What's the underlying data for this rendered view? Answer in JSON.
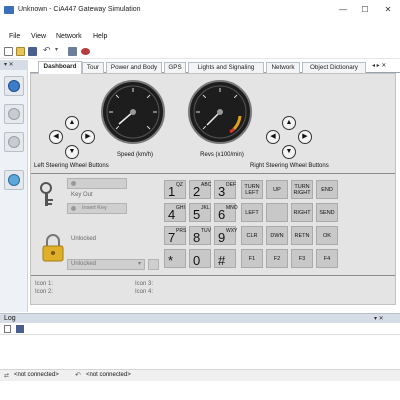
{
  "window": {
    "title": "Unknown - CiA447 Gateway Simulation",
    "minimize": "—",
    "maximize": "☐",
    "close": "✕"
  },
  "menu": [
    "File",
    "View",
    "Network",
    "Help"
  ],
  "left_dock": {
    "header_glyphs": "▾ ✕"
  },
  "tabs": [
    {
      "label": "Dashboard",
      "active": true
    },
    {
      "label": "Tour",
      "active": false
    },
    {
      "label": "Power and Body",
      "active": false
    },
    {
      "label": "GPS",
      "active": false
    },
    {
      "label": "Lights and Signaling",
      "active": false
    },
    {
      "label": "Network",
      "active": false
    },
    {
      "label": "Object Dictionary",
      "active": false
    }
  ],
  "tab_scroll": "◂ ▸ ✕",
  "gauges": {
    "speed_label": "Speed (km/h)",
    "revs_label": "Revs (x100/min)"
  },
  "steering": {
    "left_label": "Left Steering Wheel Buttons",
    "right_label": "Right Steering Wheel Buttons",
    "up": "▲",
    "down": "▼",
    "left": "◀",
    "right": "▶"
  },
  "key_section": {
    "key_out": "Key Out",
    "insert_key": "Insert Key",
    "lock_status": "Unlocked",
    "lock_dropdown": "Unlocked"
  },
  "keypad": [
    {
      "main": "1",
      "sub": "QZ"
    },
    {
      "main": "2",
      "sub": "ABC"
    },
    {
      "main": "3",
      "sub": "DEF"
    },
    {
      "main": "4",
      "sub": "GHI"
    },
    {
      "main": "5",
      "sub": "JKL"
    },
    {
      "main": "6",
      "sub": "MNO"
    },
    {
      "main": "7",
      "sub": "PRS"
    },
    {
      "main": "8",
      "sub": "TUV"
    },
    {
      "main": "9",
      "sub": "WXY"
    },
    {
      "main": "*",
      "sub": ""
    },
    {
      "main": "0",
      "sub": ""
    },
    {
      "main": "#",
      "sub": ""
    }
  ],
  "function_keys": [
    [
      "TURN LEFT",
      "UP",
      "TURN RIGHT",
      "END"
    ],
    [
      "LEFT",
      "",
      "RIGHT",
      "SEND"
    ],
    [
      "CLR",
      "DWN",
      "RETN",
      "OK"
    ],
    [
      "F1",
      "F2",
      "F3",
      "F4"
    ]
  ],
  "icons": {
    "icon1": "Icon 1:",
    "icon2": "Icon 2:",
    "icon3": "Icon 3:",
    "icon4": "Icon 4:"
  },
  "log": {
    "title": "Log",
    "header_glyphs": "▾ ✕"
  },
  "status": {
    "left": "<not connected>",
    "right": "<not connected>"
  }
}
